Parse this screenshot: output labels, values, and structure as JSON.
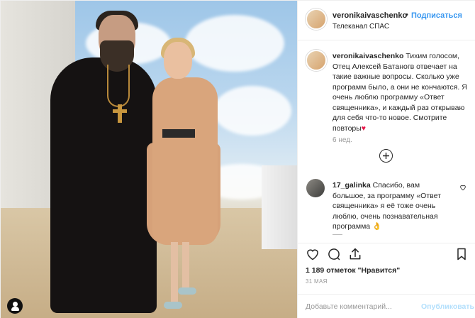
{
  "post": {
    "author": "veronikaivaschenko",
    "follow_label": "Подписаться",
    "location": "Телеканал СПАС",
    "header_separator": "•"
  },
  "caption": {
    "user": "veronikaivaschenko",
    "text": "Тихим голосом, Отец Алексей Батаногв отвечает на такие важные вопросы. Сколько уже программ было, а они не кончаются. Я очень люблю программу «Ответ священника», и каждый раз открываю для себя что-то новое. Смотрите повторы",
    "emoji": "♥",
    "time": "6 нед."
  },
  "load_more_icon": "plus-circle-icon",
  "comments": [
    {
      "user": "17_galinka",
      "text": "Спасибо, вам большое, за программу «Ответ священника» я её тоже очень люблю, очень познавательная программа",
      "emoji": "👌"
    }
  ],
  "stats": {
    "likes_text": "1 189 отметок \"Нравится\"",
    "date": "31 мая"
  },
  "add_comment": {
    "placeholder": "Добавьте комментарий...",
    "publish_label": "Опубликовать"
  },
  "colors": {
    "link_blue": "#3897f0",
    "publish_disabled": "#b2dffc",
    "heart": "#e8174a"
  }
}
